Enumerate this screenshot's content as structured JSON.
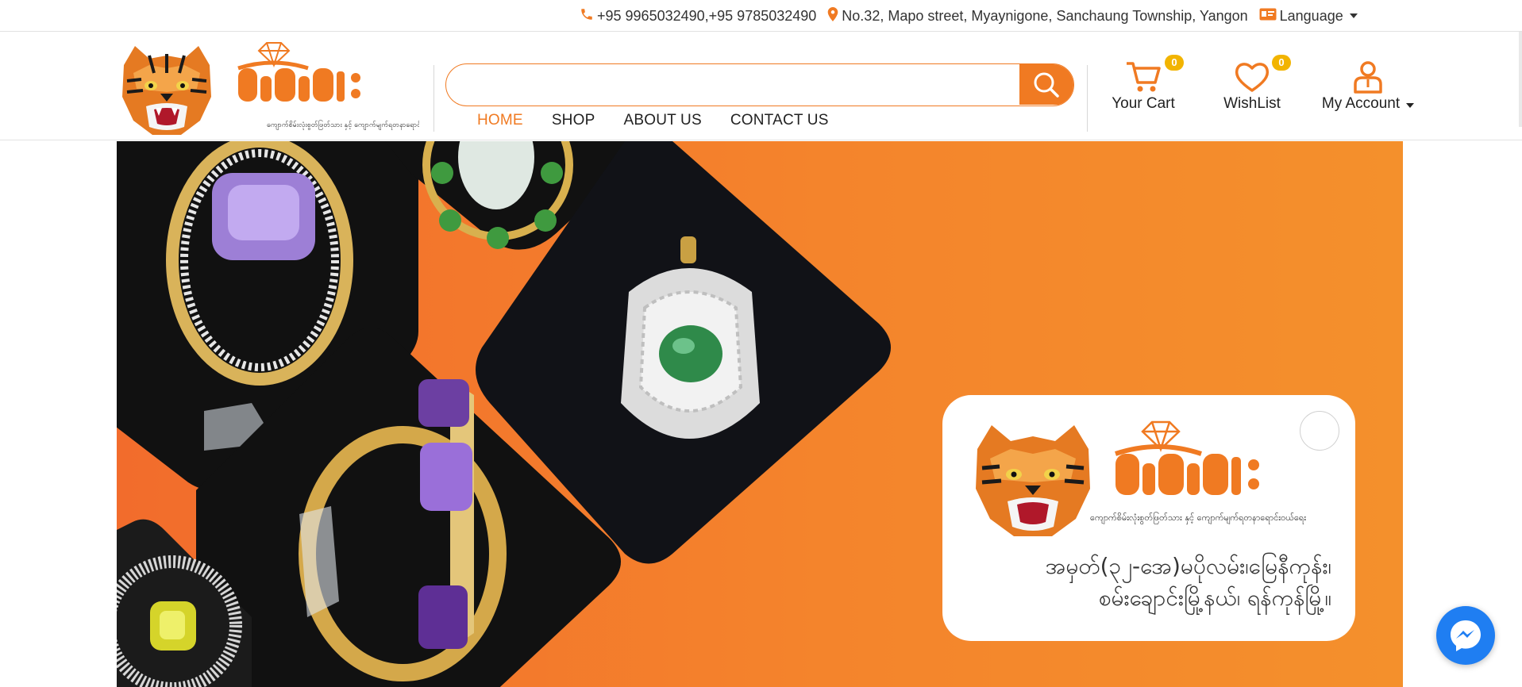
{
  "topbar": {
    "phone": "+95 9965032490,+95 9785032490",
    "address": "No.32, Mapo street, Myaynigone, Sanchaung Township, Yangon",
    "language_label": "Language"
  },
  "brand": {
    "name": "ကိုကျားကြီး",
    "tagline": "ကျောက်စိမ်းလုံးစွတ်ဖြတ်သား နှင့် ကျောက်မျက်ရတနာရောင်းဝယ်ရေး",
    "accent_color": "#f07a22"
  },
  "search": {
    "placeholder": "",
    "value": ""
  },
  "nav": {
    "items": [
      {
        "label": "HOME",
        "active": true
      },
      {
        "label": "SHOP",
        "active": false
      },
      {
        "label": "ABOUT US",
        "active": false
      },
      {
        "label": "CONTACT US",
        "active": false
      }
    ]
  },
  "header_actions": {
    "cart": {
      "label": "Your Cart",
      "count": "0",
      "icon": "cart-icon"
    },
    "wishlist": {
      "label": "WishList",
      "count": "0",
      "icon": "heart-icon"
    },
    "account": {
      "label": "My Account",
      "icon": "user-icon"
    }
  },
  "hero": {
    "card_address_line1": "အမှတ်(၃၂-အေ)မပိုလမ်း၊မြေနီကုန်း၊",
    "card_address_line2": "စမ်းချောင်းမြို့နယ်၊ ရန်ကုန်မြို့။"
  }
}
